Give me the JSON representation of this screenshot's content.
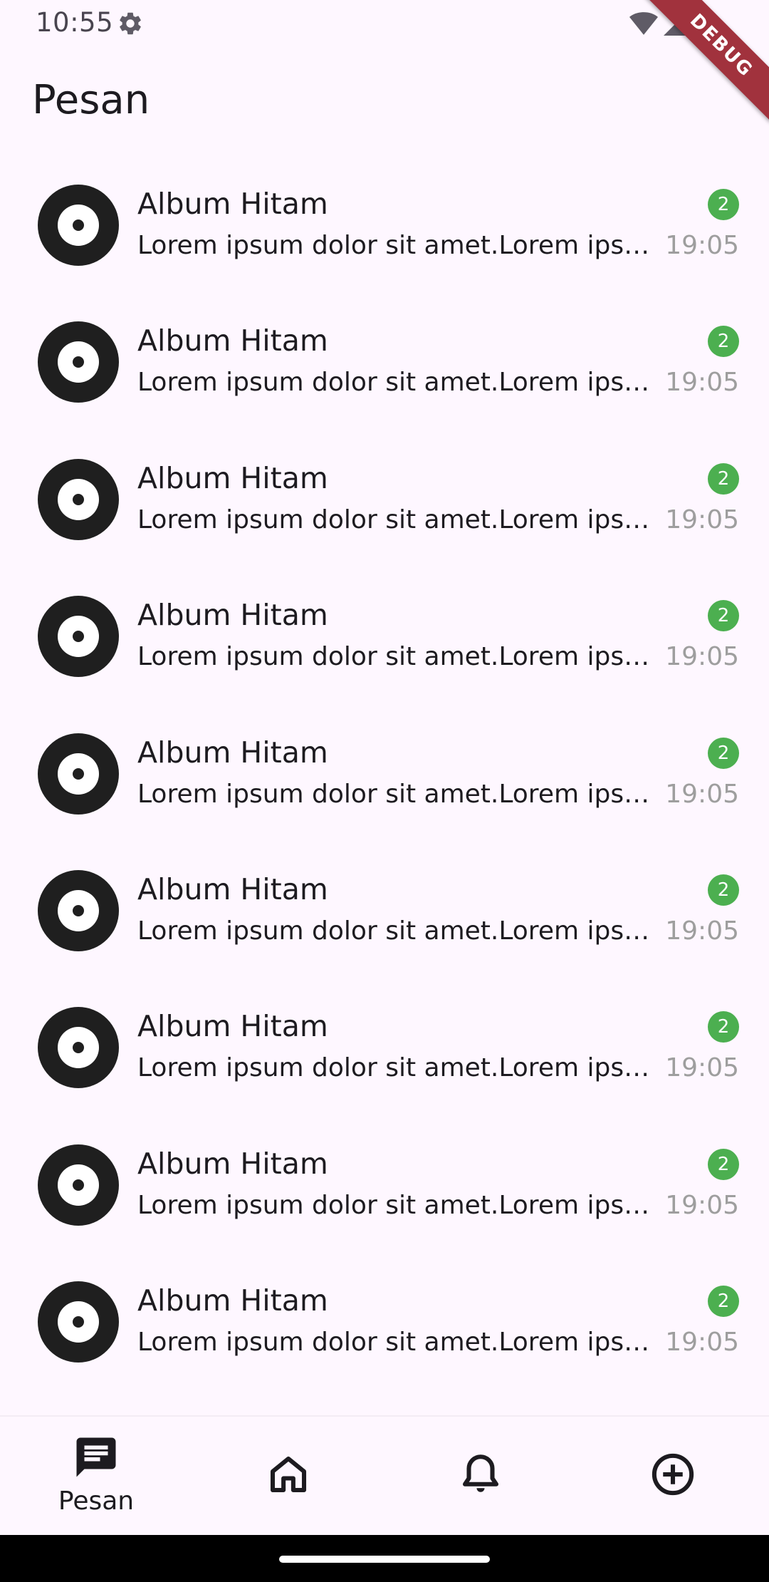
{
  "status_bar": {
    "time": "10:55"
  },
  "debug_banner": "DEBUG",
  "page_title": "Pesan",
  "messages": [
    {
      "title": "Album Hitam",
      "preview": "Lorem ipsum dolor sit amet.Lorem ipsum dolor sit amet.",
      "time": "19:05",
      "unread": "2"
    },
    {
      "title": "Album Hitam",
      "preview": "Lorem ipsum dolor sit amet.Lorem ipsum dolor sit amet.",
      "time": "19:05",
      "unread": "2"
    },
    {
      "title": "Album Hitam",
      "preview": "Lorem ipsum dolor sit amet.Lorem ipsum dolor sit amet.",
      "time": "19:05",
      "unread": "2"
    },
    {
      "title": "Album Hitam",
      "preview": "Lorem ipsum dolor sit amet.Lorem ipsum dolor sit amet.",
      "time": "19:05",
      "unread": "2"
    },
    {
      "title": "Album Hitam",
      "preview": "Lorem ipsum dolor sit amet.Lorem ipsum dolor sit amet.",
      "time": "19:05",
      "unread": "2"
    },
    {
      "title": "Album Hitam",
      "preview": "Lorem ipsum dolor sit amet.Lorem ipsum dolor sit amet.",
      "time": "19:05",
      "unread": "2"
    },
    {
      "title": "Album Hitam",
      "preview": "Lorem ipsum dolor sit amet.Lorem ipsum dolor sit amet.",
      "time": "19:05",
      "unread": "2"
    },
    {
      "title": "Album Hitam",
      "preview": "Lorem ipsum dolor sit amet.Lorem ipsum dolor sit amet.",
      "time": "19:05",
      "unread": "2"
    },
    {
      "title": "Album Hitam",
      "preview": "Lorem ipsum dolor sit amet.Lorem ipsum dolor sit amet.",
      "time": "19:05",
      "unread": "2"
    }
  ],
  "bottom_nav": {
    "items": [
      {
        "label": "Pesan",
        "icon": "chat-icon",
        "active": true
      },
      {
        "label": "",
        "icon": "home-icon"
      },
      {
        "label": "",
        "icon": "bell-icon"
      },
      {
        "label": "",
        "icon": "add-circle-icon"
      }
    ]
  },
  "colors": {
    "background": "#fef7ff",
    "badge": "#4caf50",
    "avatar": "#1f1f1f",
    "time_text": "#9e9e9e",
    "debug_ribbon": "#a1323d"
  }
}
